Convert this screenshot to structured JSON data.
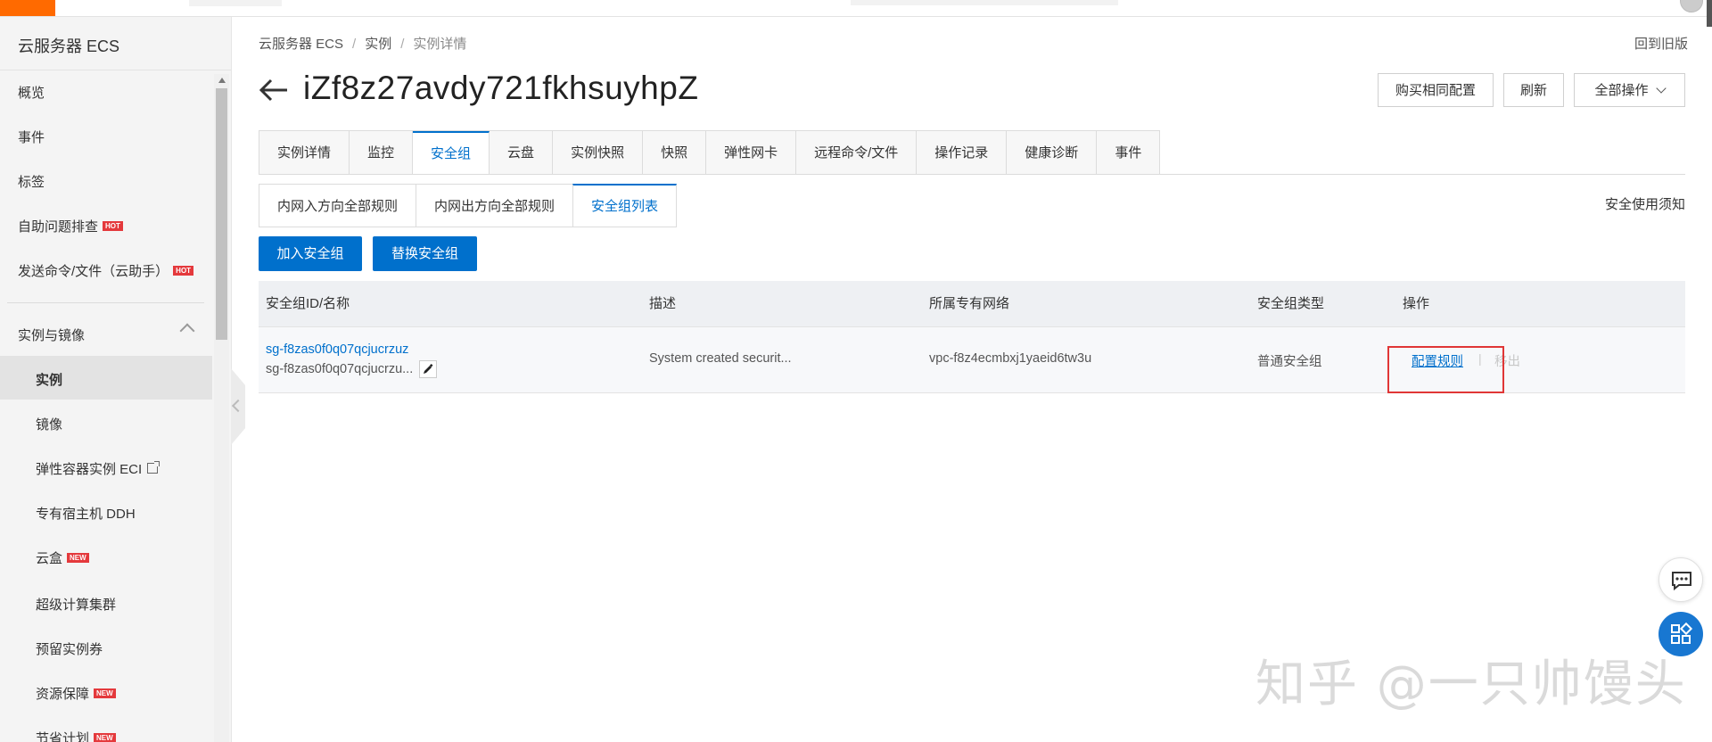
{
  "sidebar": {
    "title": "云服务器 ECS",
    "items": [
      {
        "label": "概览"
      },
      {
        "label": "事件"
      },
      {
        "label": "标签"
      },
      {
        "label": "自助问题排查",
        "badge": "HOT"
      },
      {
        "label": "发送命令/文件（云助手）",
        "badge": "HOT"
      }
    ],
    "group": {
      "label": "实例与镜像"
    },
    "subitems": [
      {
        "label": "实例",
        "active": true
      },
      {
        "label": "镜像"
      },
      {
        "label": "弹性容器实例 ECI"
      },
      {
        "label": "专有宿主机 DDH"
      },
      {
        "label": "云盒",
        "badge": "NEW"
      },
      {
        "label": "超级计算集群"
      },
      {
        "label": "预留实例券"
      },
      {
        "label": "资源保障",
        "badge": "NEW"
      },
      {
        "label": "节省计划",
        "badge": "NEW"
      }
    ]
  },
  "breadcrumb": {
    "items": [
      "云服务器 ECS",
      "实例",
      "实例详情"
    ],
    "back_old": "回到旧版"
  },
  "header": {
    "title": "iZf8z27avdy721fkhsuyhpZ",
    "buttons": [
      "购买相同配置",
      "刷新",
      "全部操作"
    ]
  },
  "tabs": {
    "items": [
      "实例详情",
      "监控",
      "安全组",
      "云盘",
      "实例快照",
      "快照",
      "弹性网卡",
      "远程命令/文件",
      "操作记录",
      "健康诊断",
      "事件"
    ],
    "active_index": 2
  },
  "subtabs": {
    "items": [
      "内网入方向全部规则",
      "内网出方向全部规则",
      "安全组列表"
    ],
    "active_index": 2,
    "notice": "安全使用须知"
  },
  "actions": {
    "join": "加入安全组",
    "replace": "替换安全组"
  },
  "table": {
    "headers": [
      "安全组ID/名称",
      "描述",
      "所属专有网络",
      "安全组类型",
      "操作"
    ],
    "rows": [
      {
        "id": "sg-f8zas0f0q07qcjucrzuz",
        "name": "sg-f8zas0f0q07qcjucrzu...",
        "description": "System created securit...",
        "vpc": "vpc-f8z4ecmbxj1yaeid6tw3u",
        "type": "普通安全组",
        "op_configure": "配置规则",
        "op_remove": "移出"
      }
    ]
  },
  "watermark": "知乎 @一只帅馒头",
  "colors": {
    "brand": "#ff6a00",
    "primary": "#0070cc",
    "highlight_box": "#e03636",
    "badge": "#e4393c"
  }
}
